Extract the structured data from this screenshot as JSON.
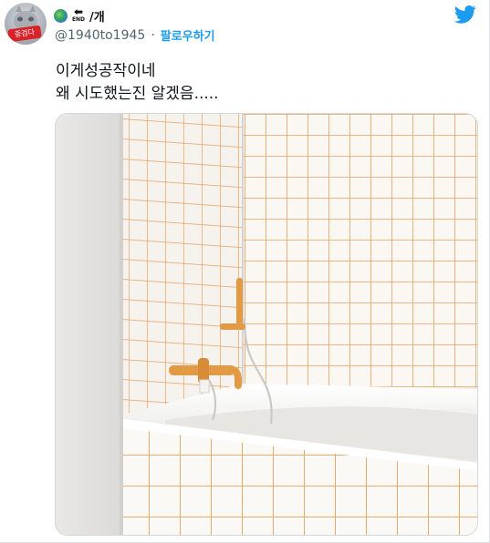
{
  "tweet": {
    "display_name_suffix": "/개",
    "end_badge": "END",
    "avatar_stamp": "중검다",
    "handle": "@1940to1945",
    "separator": "·",
    "follow_label": "팔로우하기",
    "text_line1": "이게성공작이네",
    "text_line2": "왜 시도했는진 알겠음....."
  },
  "colors": {
    "accent": "#1d9bf0",
    "grout": "#e6a15c",
    "fixture": "#e39a45"
  },
  "icons": {
    "brand": "twitter-bird-icon",
    "name_emoji_1": "globe-icon",
    "name_emoji_2": "end-arrow-icon"
  }
}
